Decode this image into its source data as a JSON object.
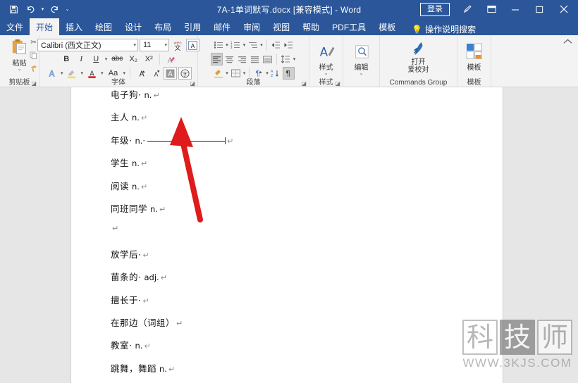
{
  "window": {
    "title": "7A-1单词默写.docx [兼容模式]  -  Word",
    "signin_label": "登录",
    "accent_color": "#2b579a",
    "quick_access": [
      {
        "name": "save-icon",
        "label": "保存"
      },
      {
        "name": "undo-icon",
        "label": "撤消"
      },
      {
        "name": "redo-icon",
        "label": "恢复"
      },
      {
        "name": "customize-qat-icon",
        "label": "自定义快速访问工具栏"
      }
    ],
    "controls": [
      {
        "name": "ink-pen-icon",
        "glyph": "✒"
      },
      {
        "name": "ribbon-display-options-icon",
        "glyph": "⊡"
      },
      {
        "name": "minimize-icon",
        "glyph": "—"
      },
      {
        "name": "maximize-icon",
        "glyph": "▢"
      },
      {
        "name": "close-icon",
        "glyph": "✕"
      }
    ]
  },
  "tabs": [
    {
      "label": "文件",
      "active": false,
      "kind": "file"
    },
    {
      "label": "开始",
      "active": true
    },
    {
      "label": "插入",
      "active": false
    },
    {
      "label": "绘图",
      "active": false
    },
    {
      "label": "设计",
      "active": false
    },
    {
      "label": "布局",
      "active": false
    },
    {
      "label": "引用",
      "active": false
    },
    {
      "label": "邮件",
      "active": false
    },
    {
      "label": "审阅",
      "active": false
    },
    {
      "label": "视图",
      "active": false
    },
    {
      "label": "帮助",
      "active": false
    },
    {
      "label": "PDF工具",
      "active": false
    },
    {
      "label": "模板",
      "active": false
    }
  ],
  "tell_me": {
    "label": "操作说明搜索",
    "icon": "lightbulb-icon"
  },
  "ribbon": {
    "clipboard": {
      "group_label": "剪贴板",
      "paste_label": "粘贴",
      "buttons": [
        {
          "name": "cut-icon",
          "label": "剪切"
        },
        {
          "name": "copy-icon",
          "label": "复制"
        },
        {
          "name": "format-painter-icon",
          "label": "格式刷"
        }
      ]
    },
    "font": {
      "group_label": "字体",
      "font_name": "Calibri (西文正文)",
      "font_size": "11",
      "buttons": [
        {
          "name": "phonetic-guide-icon",
          "label": "拼音指南"
        },
        {
          "name": "character-border-icon",
          "label": "字符边框"
        },
        {
          "name": "bold-button",
          "label": "B"
        },
        {
          "name": "italic-button",
          "label": "I"
        },
        {
          "name": "underline-button",
          "label": "U"
        },
        {
          "name": "strikethrough-button",
          "label": "abc"
        },
        {
          "name": "subscript-button",
          "label": "X₂"
        },
        {
          "name": "superscript-button",
          "label": "X²"
        },
        {
          "name": "clear-formatting-button",
          "label": "清除所有格式"
        },
        {
          "name": "text-effects-icon",
          "label": "文本效果"
        },
        {
          "name": "text-highlight-icon",
          "label": "突出显示"
        },
        {
          "name": "font-color-icon",
          "label": "字体颜色"
        },
        {
          "name": "change-case-button",
          "label": "Aa"
        },
        {
          "name": "grow-font-button",
          "label": "A"
        },
        {
          "name": "shrink-font-button",
          "label": "A"
        },
        {
          "name": "character-shading-button",
          "label": "A"
        },
        {
          "name": "enclose-character-button",
          "label": "字"
        }
      ]
    },
    "paragraph": {
      "group_label": "段落",
      "buttons": [
        {
          "name": "bullets-icon",
          "label": "项目符号"
        },
        {
          "name": "numbering-icon",
          "label": "编号"
        },
        {
          "name": "multilevel-list-icon",
          "label": "多级列表"
        },
        {
          "name": "decrease-indent-icon",
          "label": "减少缩进量"
        },
        {
          "name": "increase-indent-icon",
          "label": "增加缩进量"
        },
        {
          "name": "align-left-icon",
          "label": "左对齐"
        },
        {
          "name": "align-center-icon",
          "label": "居中"
        },
        {
          "name": "align-right-icon",
          "label": "右对齐"
        },
        {
          "name": "justify-icon",
          "label": "两端对齐"
        },
        {
          "name": "distribute-icon",
          "label": "分散对齐"
        },
        {
          "name": "line-spacing-icon",
          "label": "行距"
        },
        {
          "name": "shading-icon",
          "label": "底纹"
        },
        {
          "name": "borders-icon",
          "label": "边框"
        },
        {
          "name": "show-marks-icon",
          "label": "显示编辑标记"
        },
        {
          "name": "sort-icon",
          "label": "排序"
        }
      ]
    },
    "styles": {
      "group_label": "样式",
      "button_label": "样式"
    },
    "editing": {
      "group_label": "",
      "button_label": "编辑"
    },
    "commands": {
      "group_label": "Commands Group",
      "button_line1": "打开",
      "button_line2": "爱校对"
    },
    "template": {
      "group_label": "模板",
      "button_label": "模板"
    },
    "collapse_icon": "collapse-ribbon-icon"
  },
  "document": {
    "lines": [
      {
        "cn": "电子狗",
        "pos": "n.",
        "dotted": true,
        "blank": false
      },
      {
        "cn": "主人",
        "pos": "n.",
        "dotted": false,
        "blank": false
      },
      {
        "cn": "年级",
        "pos": "n.",
        "dotted": true,
        "blank": true
      },
      {
        "cn": "学生",
        "pos": "n.",
        "dotted": false,
        "blank": false
      },
      {
        "cn": "阅读",
        "pos": "n.",
        "dotted": false,
        "blank": false
      },
      {
        "cn": "同班同学",
        "pos": "n.",
        "dotted": false,
        "blank": false
      },
      {
        "cn": "",
        "pos": "",
        "dotted": false,
        "blank": false
      },
      {
        "cn": "放学后",
        "pos": "",
        "dotted": true,
        "blank": false
      },
      {
        "cn": "苗条的",
        "pos": "adj.",
        "dotted": true,
        "blank": false
      },
      {
        "cn": "擅长于",
        "pos": "",
        "dotted": true,
        "blank": false
      },
      {
        "cn": "在那边（词组）",
        "pos": "",
        "dotted": false,
        "blank": false
      },
      {
        "cn": "教室",
        "pos": "n.",
        "dotted": true,
        "blank": false
      },
      {
        "cn": "跳舞，舞蹈",
        "pos": "n.",
        "dotted": false,
        "blank": false
      }
    ],
    "paragraph_mark": "↵"
  },
  "annotation": {
    "name": "red-arrow-annotation",
    "color": "#e01b1b",
    "points_to": "年级 n. 后的下划线"
  },
  "watermark": {
    "chars": [
      {
        "char": "科",
        "style": "light"
      },
      {
        "char": "技",
        "style": "dark"
      },
      {
        "char": "师",
        "style": "light"
      }
    ],
    "url": "WWW.3KJS.COM"
  }
}
